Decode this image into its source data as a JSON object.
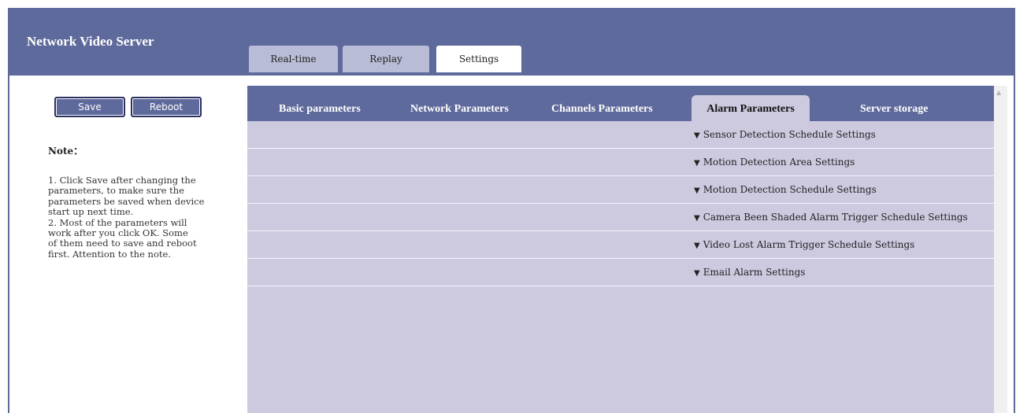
{
  "header": {
    "title": "Network Video Server",
    "tabs": [
      {
        "label": "Real-time",
        "active": false
      },
      {
        "label": "Replay",
        "active": false
      },
      {
        "label": "Settings",
        "active": true
      }
    ]
  },
  "sidebar": {
    "save_label": "Save",
    "reboot_label": "Reboot",
    "note_heading": "Note：",
    "note_lines": [
      "1. Click Save after changing the",
      "parameters, to make sure the",
      "parameters be saved when device",
      "start up next time.",
      "2. Most of the parameters will",
      "work after you click OK. Some",
      "of them need to save and reboot",
      "first. Attention to the note."
    ]
  },
  "settings": {
    "tabs": [
      {
        "label": "Basic parameters",
        "active": false
      },
      {
        "label": "Network Parameters",
        "active": false
      },
      {
        "label": "Channels Parameters",
        "active": false
      },
      {
        "label": "Alarm Parameters",
        "active": true
      },
      {
        "label": "Server storage",
        "active": false
      }
    ],
    "rows": [
      {
        "label": "Sensor Detection Schedule Settings",
        "icon": "caret-down-icon"
      },
      {
        "label": "Motion Detection Area Settings",
        "icon": "caret-down-icon"
      },
      {
        "label": "Motion Detection Schedule Settings",
        "icon": "caret-down-icon"
      },
      {
        "label": "Camera Been Shaded Alarm Trigger Schedule Settings",
        "icon": "caret-down-icon"
      },
      {
        "label": "Video Lost Alarm Trigger Schedule Settings",
        "icon": "caret-down-icon"
      },
      {
        "label": "Email Alarm Settings",
        "icon": "caret-down-icon"
      }
    ]
  },
  "colors": {
    "header_bg": "#5f6a9c",
    "tab_inactive": "#b9bcd6",
    "content_bg": "#cdcae0"
  }
}
